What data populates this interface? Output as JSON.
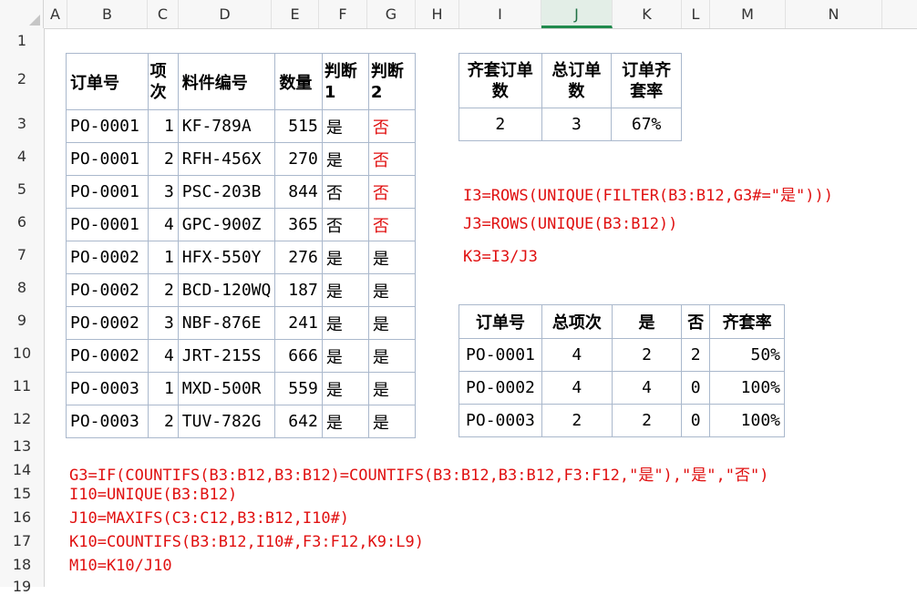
{
  "columns": [
    "A",
    "B",
    "C",
    "D",
    "E",
    "F",
    "G",
    "H",
    "I",
    "J",
    "K",
    "L",
    "M",
    "N"
  ],
  "selected_column": "J",
  "rows": [
    "1",
    "2",
    "3",
    "4",
    "5",
    "6",
    "7",
    "8",
    "9",
    "10",
    "11",
    "12",
    "13",
    "14",
    "15",
    "16",
    "17",
    "18",
    "19"
  ],
  "table1": {
    "headers": [
      "订单号",
      "项次",
      "料件编号",
      "数量",
      "判断1",
      "判断2"
    ],
    "rows": [
      [
        "PO-0001",
        "1",
        "KF-789A",
        "515",
        "是",
        "否"
      ],
      [
        "PO-0001",
        "2",
        "RFH-456X",
        "270",
        "是",
        "否"
      ],
      [
        "PO-0001",
        "3",
        "PSC-203B",
        "844",
        "否",
        "否"
      ],
      [
        "PO-0001",
        "4",
        "GPC-900Z",
        "365",
        "否",
        "否"
      ],
      [
        "PO-0002",
        "1",
        "HFX-550Y",
        "276",
        "是",
        "是"
      ],
      [
        "PO-0002",
        "2",
        "BCD-120WQ",
        "187",
        "是",
        "是"
      ],
      [
        "PO-0002",
        "3",
        "NBF-876E",
        "241",
        "是",
        "是"
      ],
      [
        "PO-0002",
        "4",
        "JRT-215S",
        "666",
        "是",
        "是"
      ],
      [
        "PO-0003",
        "1",
        "MXD-500R",
        "559",
        "是",
        "是"
      ],
      [
        "PO-0003",
        "2",
        "TUV-782G",
        "642",
        "是",
        "是"
      ]
    ]
  },
  "table2": {
    "headers": [
      "齐套订单数",
      "总订单数",
      "订单齐套率"
    ],
    "values": [
      "2",
      "3",
      "67%"
    ]
  },
  "table3": {
    "headers": [
      "订单号",
      "总项次",
      "是",
      "否",
      "齐套率"
    ],
    "rows": [
      [
        "PO-0001",
        "4",
        "2",
        "2",
        "50%"
      ],
      [
        "PO-0002",
        "4",
        "4",
        "0",
        "100%"
      ],
      [
        "PO-0003",
        "2",
        "2",
        "0",
        "100%"
      ]
    ]
  },
  "formulas_right": [
    "I3=ROWS(UNIQUE(FILTER(B3:B12,G3#=\"是\")))",
    "J3=ROWS(UNIQUE(B3:B12))",
    "K3=I3/J3"
  ],
  "formulas_bottom": [
    "G3=IF(COUNTIFS(B3:B12,B3:B12)=COUNTIFS(B3:B12,B3:B12,F3:F12,\"是\"),\"是\",\"否\")",
    "I10=UNIQUE(B3:B12)",
    "J10=MAXIFS(C3:C12,B3:B12,I10#)",
    "K10=COUNTIFS(B3:B12,I10#,F3:F12,K9:L9)",
    "M10=K10/J10"
  ],
  "colors": {
    "formula": "#e01010",
    "selected_header": "#1f8a4c",
    "grid_border": "#aab8cc"
  }
}
